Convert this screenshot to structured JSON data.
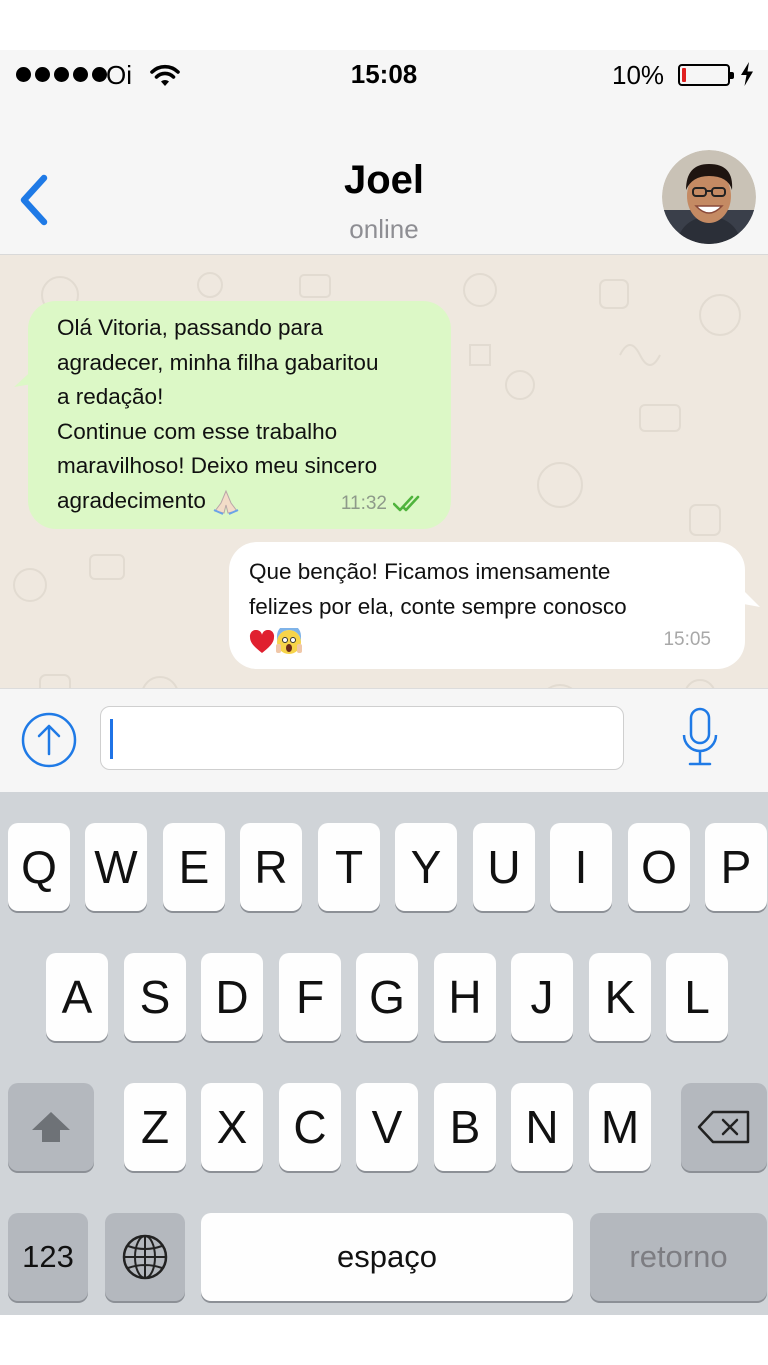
{
  "status_bar": {
    "carrier": "Oi",
    "time": "15:08",
    "battery_percent": "10%",
    "battery_level": 0.1,
    "battery_color": "#e02020"
  },
  "nav": {
    "back_icon": "chevron-left-icon",
    "contact_name": "Joel",
    "contact_status": "online",
    "accent_color": "#1f7ae6"
  },
  "messages": [
    {
      "direction": "incoming",
      "lines": [
        "Olá Vitoria, passando para",
        "agradecer, minha filha gabaritou",
        "a redação!",
        "Continue com esse trabalho",
        "maravilhoso! Deixo meu sincero",
        "agradecimento"
      ],
      "emoji": "folded-hands-emoji",
      "time": "11:32",
      "status_icon": "double-check-icon",
      "bubble_color": "#dcf8c6"
    },
    {
      "direction": "outgoing",
      "lines": [
        "Que benção! Ficamos imensamente",
        "felizes por ela, conte sempre conosco"
      ],
      "emojis": [
        "red-heart-emoji",
        "screaming-face-emoji"
      ],
      "time": "15:05",
      "bubble_color": "#ffffff"
    }
  ],
  "input": {
    "value": "",
    "attach_icon": "arrow-up-circle-icon",
    "mic_icon": "microphone-icon"
  },
  "keyboard": {
    "row1": [
      "Q",
      "W",
      "E",
      "R",
      "T",
      "Y",
      "U",
      "I",
      "O",
      "P"
    ],
    "row2": [
      "A",
      "S",
      "D",
      "F",
      "G",
      "H",
      "J",
      "K",
      "L"
    ],
    "row3": [
      "Z",
      "X",
      "C",
      "V",
      "B",
      "N",
      "M"
    ],
    "shift_icon": "shift-arrow-icon",
    "backspace_icon": "backspace-icon",
    "numbers_label": "123",
    "globe_icon": "globe-icon",
    "space_label": "espaço",
    "return_label": "retorno"
  }
}
